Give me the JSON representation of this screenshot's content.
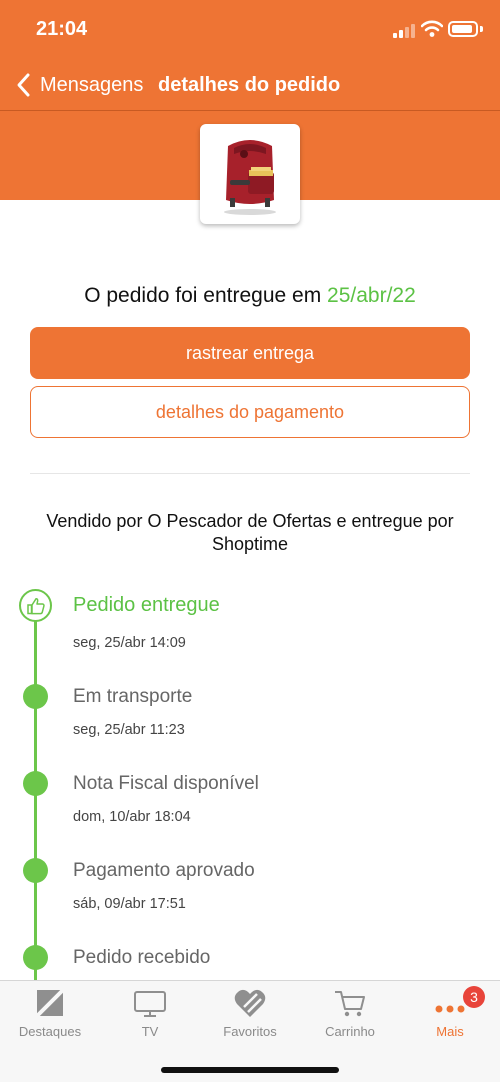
{
  "status_bar": {
    "time": "21:04"
  },
  "nav": {
    "back_label": "Mensagens",
    "title": "detalhes do pedido"
  },
  "order": {
    "status_text": "O pedido foi entregue em",
    "delivery_date": "25/abr/22",
    "track_button": "rastrear entrega",
    "payment_button": "detalhes do pagamento",
    "seller_info": "Vendido por O Pescador de Ofertas e entregue por Shoptime"
  },
  "timeline": [
    {
      "title": "Pedido entregue",
      "date": "seg, 25/abr 14:09",
      "icon": "thumbs-up-icon"
    },
    {
      "title": "Em transporte",
      "date": "seg, 25/abr 11:23"
    },
    {
      "title": "Nota Fiscal disponível",
      "date": "dom, 10/abr 18:04"
    },
    {
      "title": "Pagamento aprovado",
      "date": "sáb, 09/abr 17:51"
    },
    {
      "title": "Pedido recebido",
      "date": ""
    }
  ],
  "tabs": [
    {
      "label": "Destaques",
      "icon": "highlights-icon"
    },
    {
      "label": "TV",
      "icon": "tv-icon"
    },
    {
      "label": "Favoritos",
      "icon": "heart-icon"
    },
    {
      "label": "Carrinho",
      "icon": "cart-icon"
    },
    {
      "label": "Mais",
      "icon": "more-dots-icon",
      "badge": "3"
    }
  ],
  "colors": {
    "brand_orange": "#ee7434",
    "success_green": "#5cc245",
    "badge_red": "#e8443a"
  }
}
